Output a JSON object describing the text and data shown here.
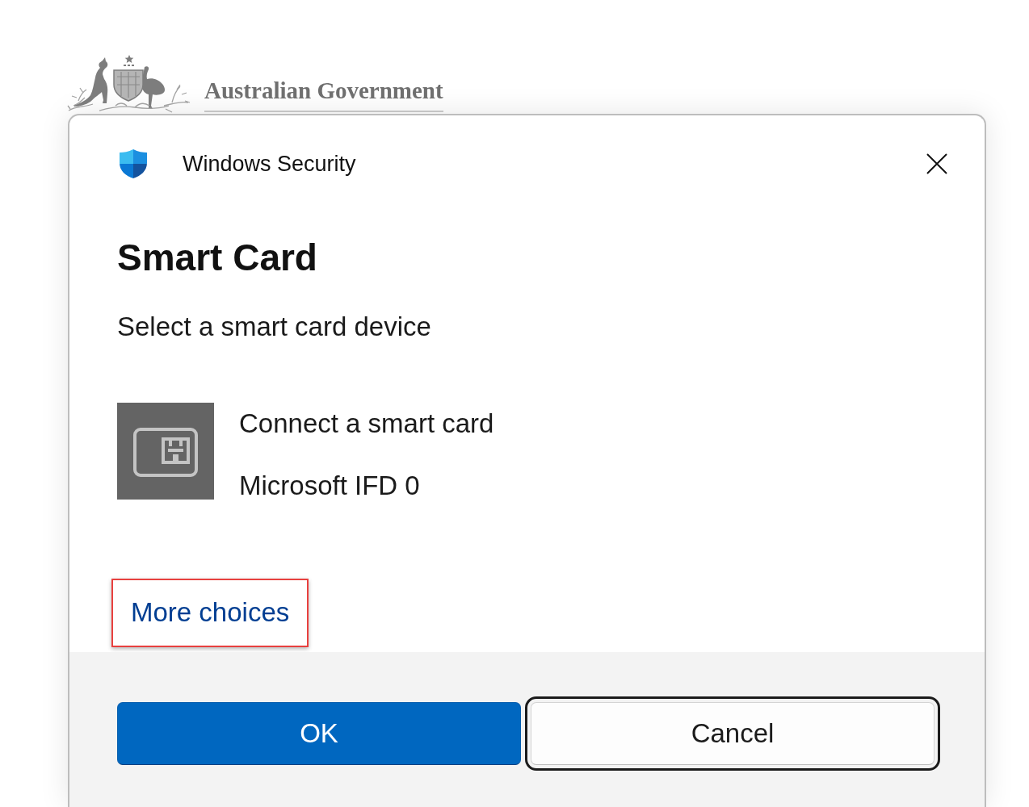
{
  "background": {
    "logo": {
      "text": "Australian Government"
    }
  },
  "dialog": {
    "app_title": "Windows Security",
    "title": "Smart Card",
    "subtitle": "Select a smart card device",
    "devices": [
      {
        "status": "Connect a smart card",
        "reader": "Microsoft IFD 0"
      }
    ],
    "more_choices": {
      "label": "More choices",
      "highlighted": true
    },
    "buttons": [
      {
        "label": "OK",
        "kind": "primary",
        "focused": false
      },
      {
        "label": "Cancel",
        "kind": "secondary",
        "focused": true
      }
    ]
  }
}
